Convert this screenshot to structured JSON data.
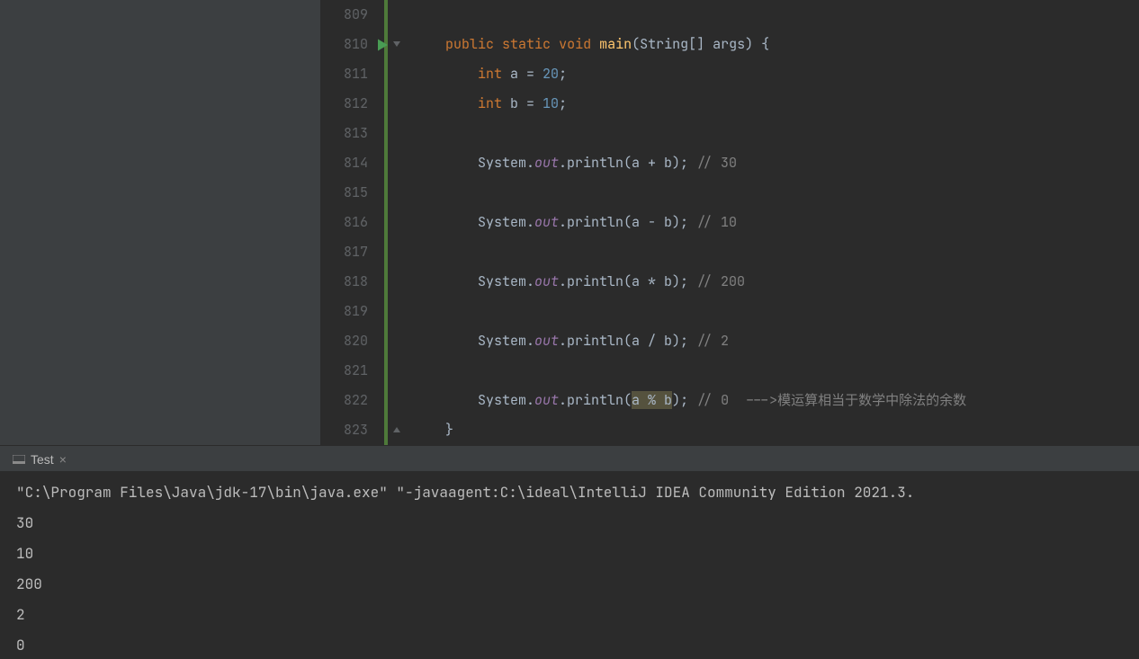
{
  "editor": {
    "lines": [
      {
        "num": "809",
        "fold": null,
        "run": false,
        "tokens": []
      },
      {
        "num": "810",
        "fold": "open",
        "run": true,
        "tokens": [
          {
            "t": "    ",
            "c": ""
          },
          {
            "t": "public",
            "c": "tok-kw"
          },
          {
            "t": " ",
            "c": ""
          },
          {
            "t": "static",
            "c": "tok-kw"
          },
          {
            "t": " ",
            "c": ""
          },
          {
            "t": "void",
            "c": "tok-kw"
          },
          {
            "t": " ",
            "c": ""
          },
          {
            "t": "main",
            "c": "tok-fn"
          },
          {
            "t": "(",
            "c": ""
          },
          {
            "t": "String[] args) {",
            "c": ""
          }
        ]
      },
      {
        "num": "811",
        "fold": null,
        "run": false,
        "tokens": [
          {
            "t": "        ",
            "c": ""
          },
          {
            "t": "int",
            "c": "tok-type"
          },
          {
            "t": " a = ",
            "c": ""
          },
          {
            "t": "20",
            "c": "tok-num"
          },
          {
            "t": ";",
            "c": ""
          }
        ]
      },
      {
        "num": "812",
        "fold": null,
        "run": false,
        "tokens": [
          {
            "t": "        ",
            "c": ""
          },
          {
            "t": "int",
            "c": "tok-type"
          },
          {
            "t": " b = ",
            "c": ""
          },
          {
            "t": "10",
            "c": "tok-num"
          },
          {
            "t": ";",
            "c": ""
          }
        ]
      },
      {
        "num": "813",
        "fold": null,
        "run": false,
        "tokens": []
      },
      {
        "num": "814",
        "fold": null,
        "run": false,
        "tokens": [
          {
            "t": "        System.",
            "c": ""
          },
          {
            "t": "out",
            "c": "tok-field"
          },
          {
            "t": ".println(a + b); ",
            "c": ""
          },
          {
            "t": "// 30",
            "c": "tok-cmt"
          }
        ]
      },
      {
        "num": "815",
        "fold": null,
        "run": false,
        "tokens": []
      },
      {
        "num": "816",
        "fold": null,
        "run": false,
        "tokens": [
          {
            "t": "        System.",
            "c": ""
          },
          {
            "t": "out",
            "c": "tok-field"
          },
          {
            "t": ".println(a - b); ",
            "c": ""
          },
          {
            "t": "// 10",
            "c": "tok-cmt"
          }
        ]
      },
      {
        "num": "817",
        "fold": null,
        "run": false,
        "tokens": []
      },
      {
        "num": "818",
        "fold": null,
        "run": false,
        "tokens": [
          {
            "t": "        System.",
            "c": ""
          },
          {
            "t": "out",
            "c": "tok-field"
          },
          {
            "t": ".println(a * b); ",
            "c": ""
          },
          {
            "t": "// 200",
            "c": "tok-cmt"
          }
        ]
      },
      {
        "num": "819",
        "fold": null,
        "run": false,
        "tokens": []
      },
      {
        "num": "820",
        "fold": null,
        "run": false,
        "tokens": [
          {
            "t": "        System.",
            "c": ""
          },
          {
            "t": "out",
            "c": "tok-field"
          },
          {
            "t": ".println(a / b); ",
            "c": ""
          },
          {
            "t": "// 2",
            "c": "tok-cmt"
          }
        ]
      },
      {
        "num": "821",
        "fold": null,
        "run": false,
        "tokens": []
      },
      {
        "num": "822",
        "fold": null,
        "run": false,
        "tokens": [
          {
            "t": "        System.",
            "c": ""
          },
          {
            "t": "out",
            "c": "tok-field"
          },
          {
            "t": ".println(",
            "c": ""
          },
          {
            "t": "a % b",
            "c": "tok-sel"
          },
          {
            "t": "); ",
            "c": ""
          },
          {
            "t": "// 0  --->模运算相当于数学中除法的余数",
            "c": "tok-cmt"
          }
        ]
      },
      {
        "num": "823",
        "fold": "close",
        "run": false,
        "tokens": [
          {
            "t": "    }",
            "c": ""
          }
        ]
      }
    ]
  },
  "tab": {
    "label": "Test",
    "close_glyph": "×"
  },
  "console": {
    "lines": [
      "\"C:\\Program Files\\Java\\jdk-17\\bin\\java.exe\" \"-javaagent:C:\\ideal\\IntelliJ IDEA Community Edition 2021.3.",
      "30",
      "10",
      "200",
      "2",
      "0"
    ]
  }
}
